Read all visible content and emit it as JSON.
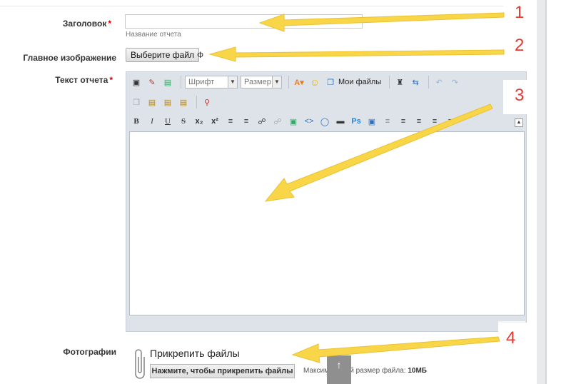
{
  "form": {
    "title_label": "Заголовок",
    "required_mark": "*",
    "title_value": "",
    "title_hint": "Название отчета",
    "image_label": "Главное изображение",
    "file_button": "Выберите файл",
    "file_status": "Ф",
    "text_label": "Текст отчета",
    "photos_label": "Фотографии"
  },
  "toolbar": {
    "font_select": "Шрифт",
    "size_select": "Размер",
    "my_files": "Мои файлы",
    "bold": "B",
    "italic": "I",
    "underline": "U",
    "strike": "S",
    "subscript": "x₂",
    "superscript": "x²"
  },
  "attachments": {
    "title": "Прикрепить файлы",
    "button": "Нажмите, чтобы прикрепить файлы",
    "max_size_label": "Максимальный размер файла:",
    "max_size_value": "10МБ",
    "upload_arrow": "↑"
  },
  "annotations": {
    "n1": "1",
    "n2": "2",
    "n3": "3",
    "n4": "4",
    "arrow_color": "#f9d648",
    "number_color": "#e53935"
  }
}
